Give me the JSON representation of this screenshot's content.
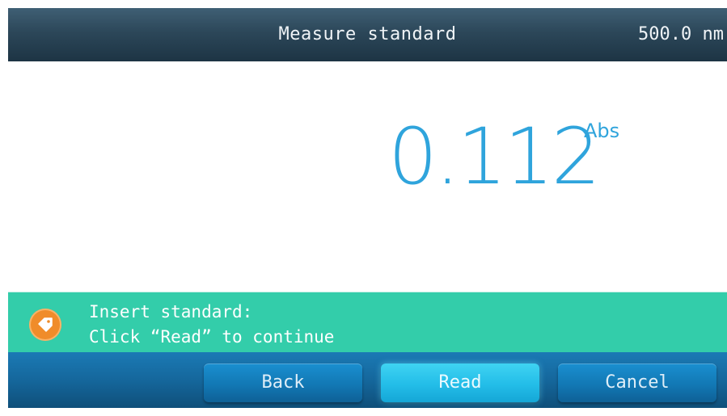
{
  "header": {
    "title": "Measure standard",
    "wavelength": "500.0 nm"
  },
  "measurement": {
    "value": "0.112",
    "unit": "Abs"
  },
  "status": {
    "icon": "tag-icon",
    "line1": "Insert standard:",
    "line2": "Click “Read” to continue"
  },
  "footer": {
    "back_label": "Back",
    "read_label": "Read",
    "cancel_label": "Cancel"
  },
  "colors": {
    "header": "#2c4759",
    "reading": "#2fa4dc",
    "status_bar": "#33cdaa",
    "status_icon": "#f08c2a",
    "footer": "#15679c",
    "active_button": "#23bde8"
  }
}
